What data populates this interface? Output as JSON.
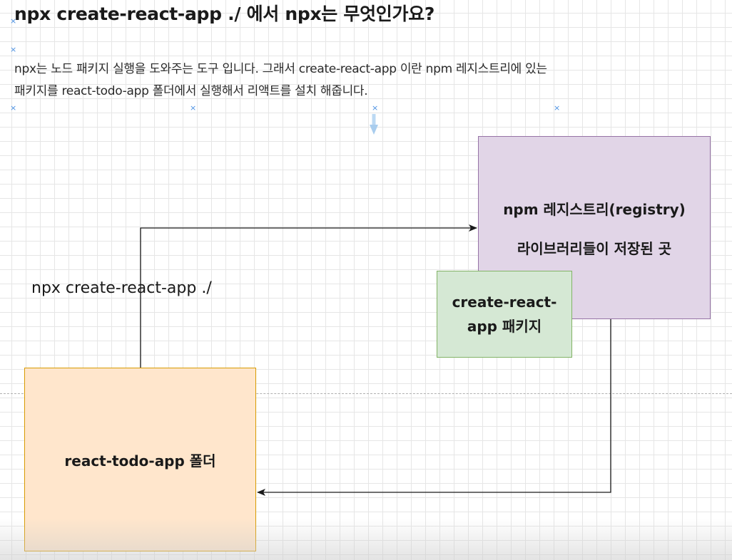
{
  "title": "npx create-react-app ./ 에서 npx는 무엇인가요?",
  "description": {
    "line1": "npx는  노드 패키지 실행을 도와주는 도구 입니다. 그래서 create-react-app 이란 npm 레지스트리에 있는",
    "line2": "패키지를 react-todo-app 폴더에서 실행해서 리액트를 설치 해줍니다."
  },
  "nodes": {
    "npm_registry": {
      "line1": "npm 레지스트리(registry)",
      "line2": "라이브러리들이 저장된 곳",
      "fill": "#e1d5e7",
      "stroke": "#9673a6"
    },
    "package": {
      "line1": "create-react-",
      "line2": "app 패키지",
      "fill": "#d5e8d4",
      "stroke": "#82b366"
    },
    "folder": {
      "label": "react-todo-app 폴더",
      "fill": "#ffe6cc",
      "stroke": "#d79b00"
    }
  },
  "edges": {
    "command_label": "npx create-react-app ./"
  }
}
